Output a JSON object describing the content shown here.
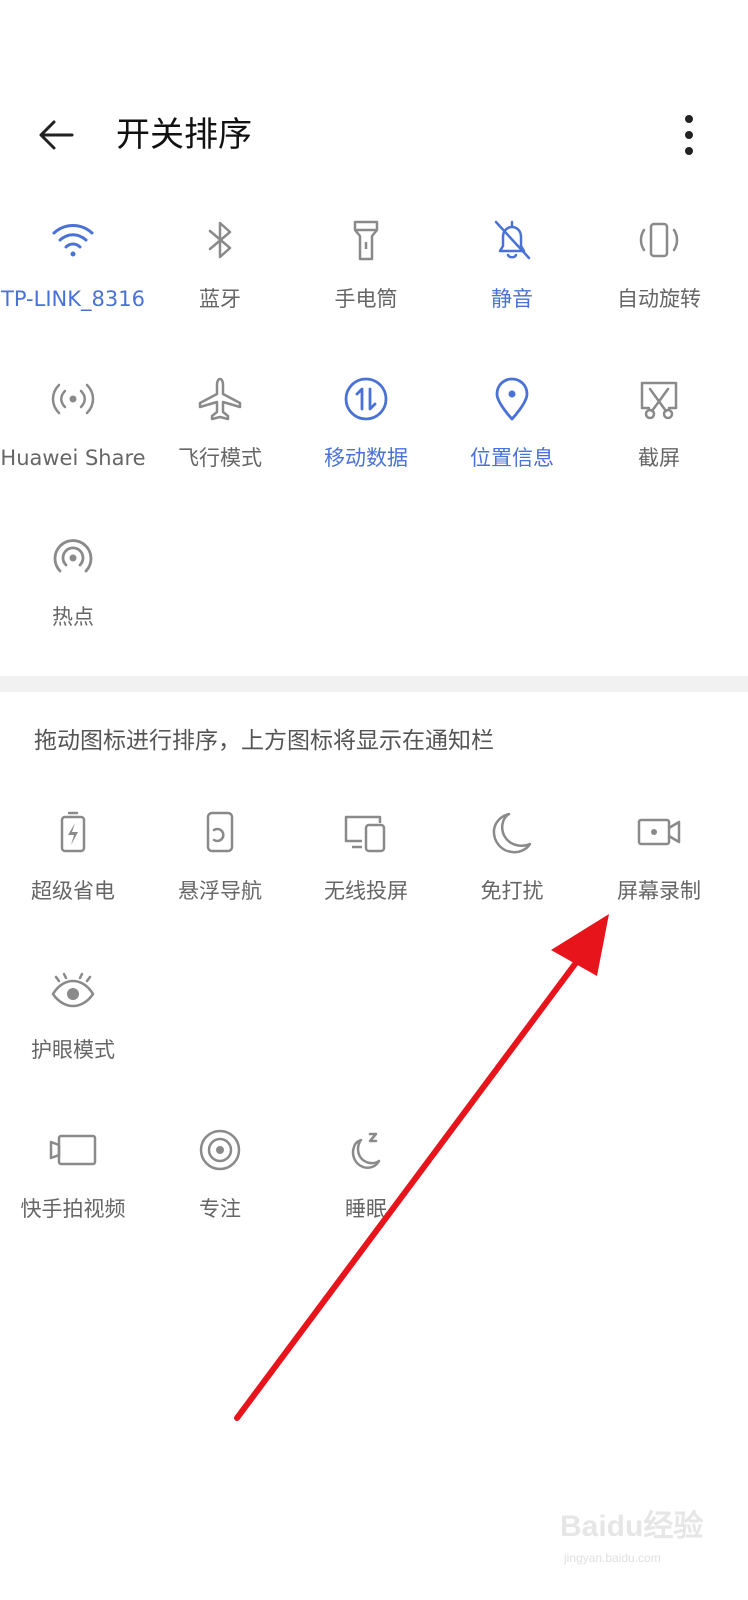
{
  "header": {
    "title": "开关排序",
    "back_icon": "arrow-left-icon",
    "more_icon": "more-vertical-icon"
  },
  "colors": {
    "active": "#4a72d6",
    "inactive_icon": "#8a8a8a",
    "label": "#666666",
    "annotation_arrow": "#e8141c"
  },
  "active_tiles": [
    {
      "label": "TP-LINK_8316",
      "icon": "wifi-icon",
      "active": true
    },
    {
      "label": "蓝牙",
      "icon": "bluetooth-icon",
      "active": false
    },
    {
      "label": "手电筒",
      "icon": "flashlight-icon",
      "active": false
    },
    {
      "label": "静音",
      "icon": "bell-off-icon",
      "active": true
    },
    {
      "label": "自动旋转",
      "icon": "auto-rotate-icon",
      "active": false
    },
    {
      "label": "Huawei Share",
      "icon": "huawei-share-icon",
      "active": false
    },
    {
      "label": "飞行模式",
      "icon": "airplane-icon",
      "active": false
    },
    {
      "label": "移动数据",
      "icon": "mobile-data-icon",
      "active": true
    },
    {
      "label": "位置信息",
      "icon": "location-icon",
      "active": true
    },
    {
      "label": "截屏",
      "icon": "screenshot-icon",
      "active": false
    },
    {
      "label": "热点",
      "icon": "hotspot-icon",
      "active": false
    }
  ],
  "hint": "拖动图标进行排序，上方图标将显示在通知栏",
  "inactive_tiles": [
    {
      "label": "超级省电",
      "icon": "battery-saver-icon"
    },
    {
      "label": "悬浮导航",
      "icon": "floating-nav-icon"
    },
    {
      "label": "无线投屏",
      "icon": "wireless-projection-icon"
    },
    {
      "label": "免打扰",
      "icon": "moon-icon"
    },
    {
      "label": "屏幕录制",
      "icon": "screen-record-icon"
    },
    {
      "label": "护眼模式",
      "icon": "eye-comfort-icon"
    }
  ],
  "extra_tiles": [
    {
      "label": "快手拍视频",
      "icon": "video-shoot-icon"
    },
    {
      "label": "专注",
      "icon": "focus-icon"
    },
    {
      "label": "睡眠",
      "icon": "sleep-icon"
    }
  ],
  "watermark": {
    "brand": "Baidu经验",
    "url": "jingyan.baidu.com"
  }
}
